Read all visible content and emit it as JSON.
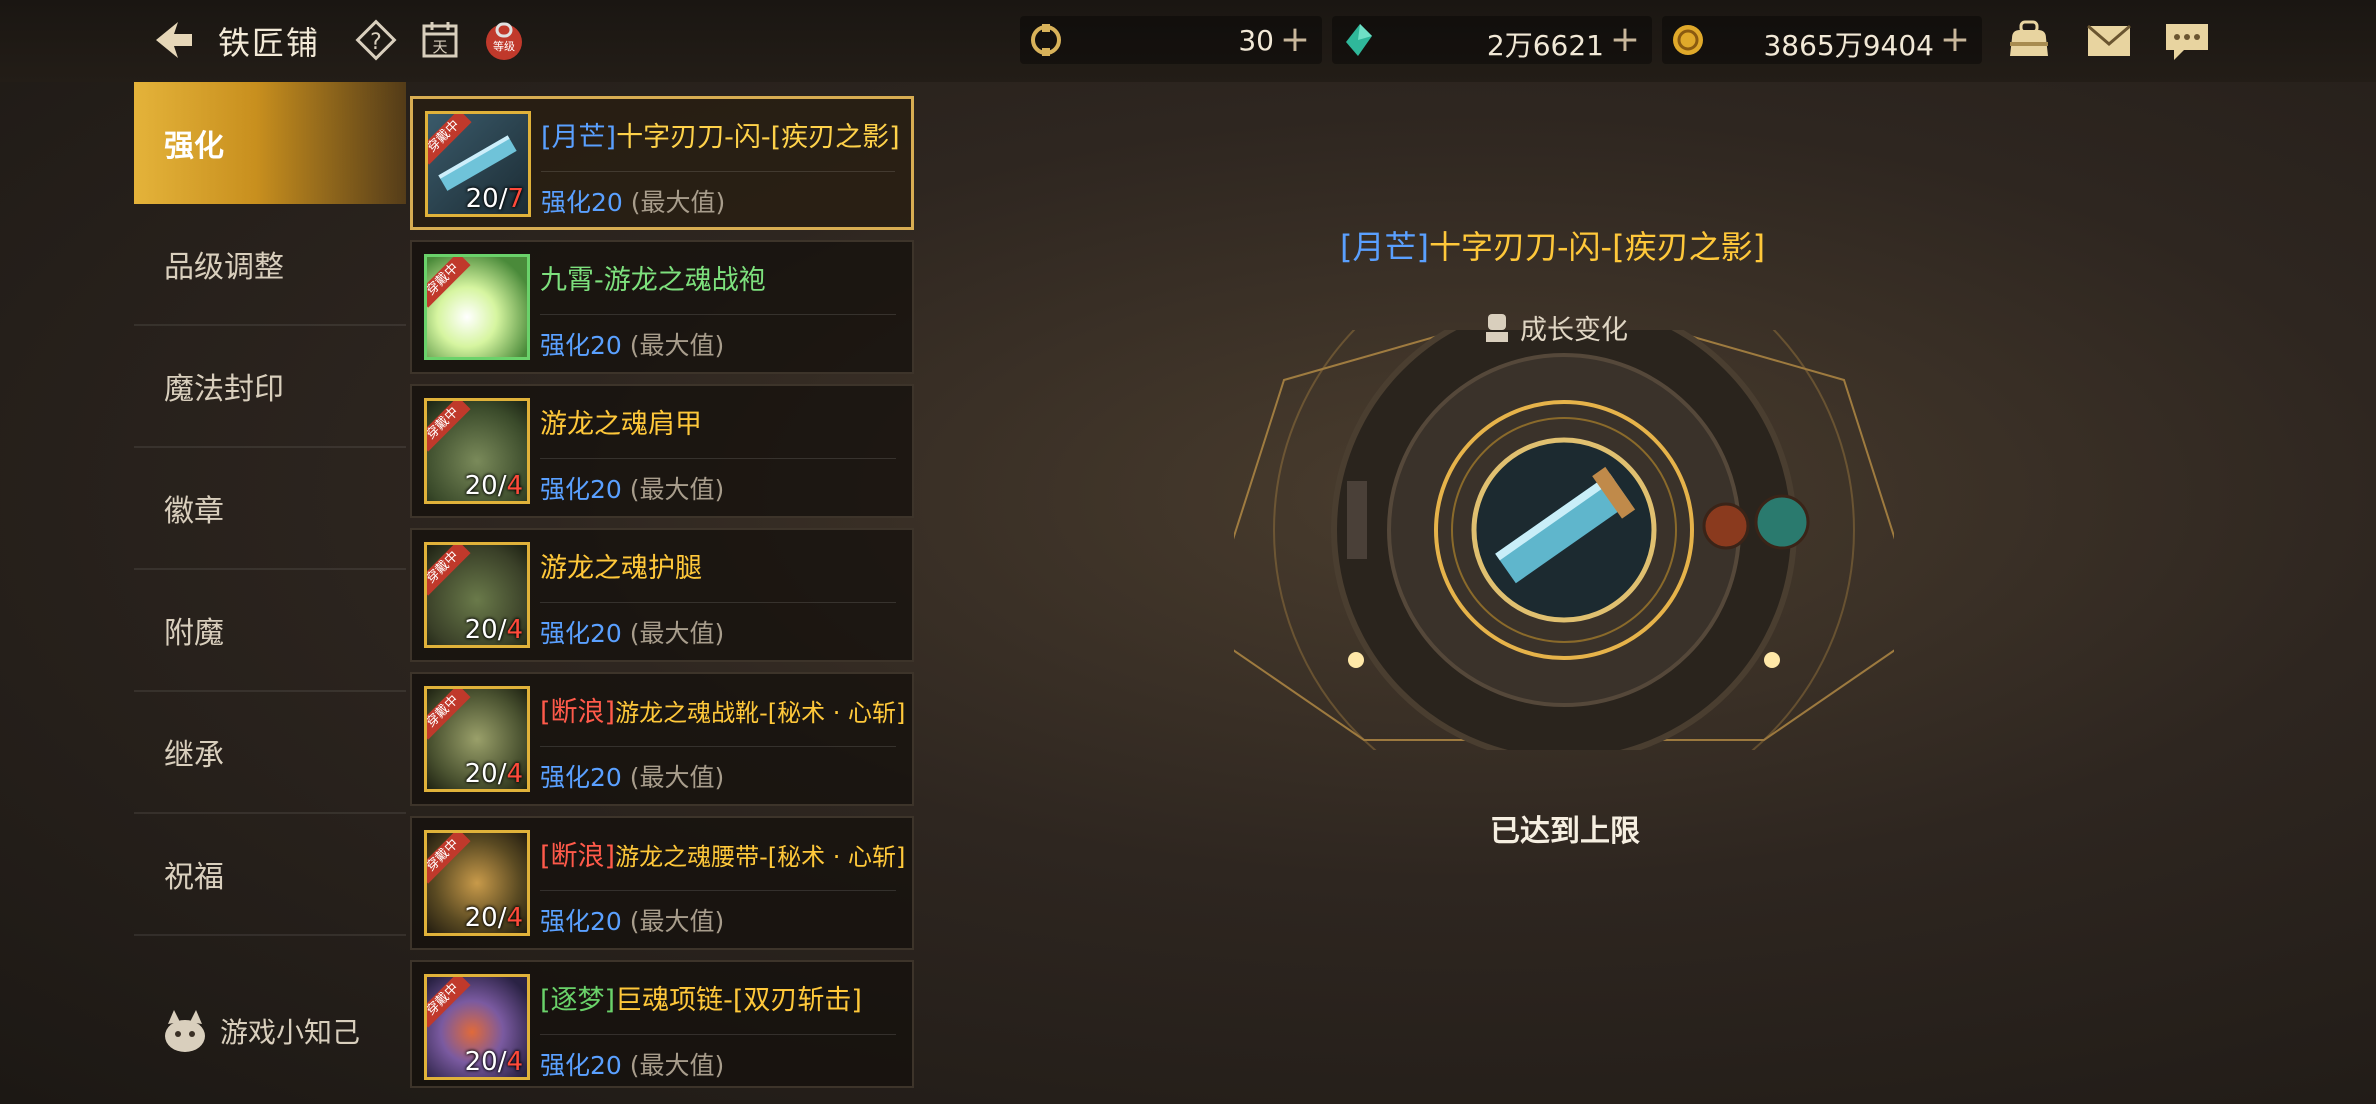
{
  "header": {
    "title": "铁匠铺",
    "resources": [
      {
        "icon": "energy-icon",
        "value": "30"
      },
      {
        "icon": "crystal-icon",
        "value": "2万6621"
      },
      {
        "icon": "gold-coin-icon",
        "value": "3865万9404"
      }
    ]
  },
  "sidebar": {
    "items": [
      {
        "label": "强化"
      },
      {
        "label": "品级调整"
      },
      {
        "label": "魔法封印"
      },
      {
        "label": "徽章"
      },
      {
        "label": "附魔"
      },
      {
        "label": "继承"
      },
      {
        "label": "祝福"
      }
    ],
    "tips_label": "游戏小知己"
  },
  "equipment": [
    {
      "prefix": "[月芒]",
      "name": "十字刃刀-闪-[疾刃之影]",
      "level": "20/",
      "max": "7",
      "stat": "强化20",
      "note": "(最大值)"
    },
    {
      "prefix": "",
      "name": "九霄-游龙之魂战袍",
      "level": "",
      "max": "",
      "stat": "强化20",
      "note": "(最大值)"
    },
    {
      "prefix": "",
      "name": "游龙之魂肩甲",
      "level": "20/",
      "max": "4",
      "stat": "强化20",
      "note": "(最大值)"
    },
    {
      "prefix": "",
      "name": "游龙之魂护腿",
      "level": "20/",
      "max": "4",
      "stat": "强化20",
      "note": "(最大值)"
    },
    {
      "prefix": "[断浪]",
      "name": "游龙之魂战靴-[秘术 · 心斩]",
      "level": "20/",
      "max": "4",
      "stat": "强化20",
      "note": "(最大值)"
    },
    {
      "prefix": "[断浪]",
      "name": "游龙之魂腰带-[秘术 · 心斩]",
      "level": "20/",
      "max": "4",
      "stat": "强化20",
      "note": "(最大值)"
    },
    {
      "prefix": "[逐梦]",
      "name": "巨魂项链-[双刃斩击]",
      "level": "20/",
      "max": "4",
      "stat": "强化20",
      "note": "(最大值)"
    }
  ],
  "equip_tag": "穿戴中",
  "detail": {
    "prefix": "[月芒]",
    "name": "十字刃刀-闪-[疾刃之影]",
    "growth_label": "成长变化",
    "status": "已达到上限"
  },
  "colors": {
    "accent": "#e4b33a",
    "blue_text": "#5aa0ff",
    "gold_text": "#ffc83a"
  }
}
